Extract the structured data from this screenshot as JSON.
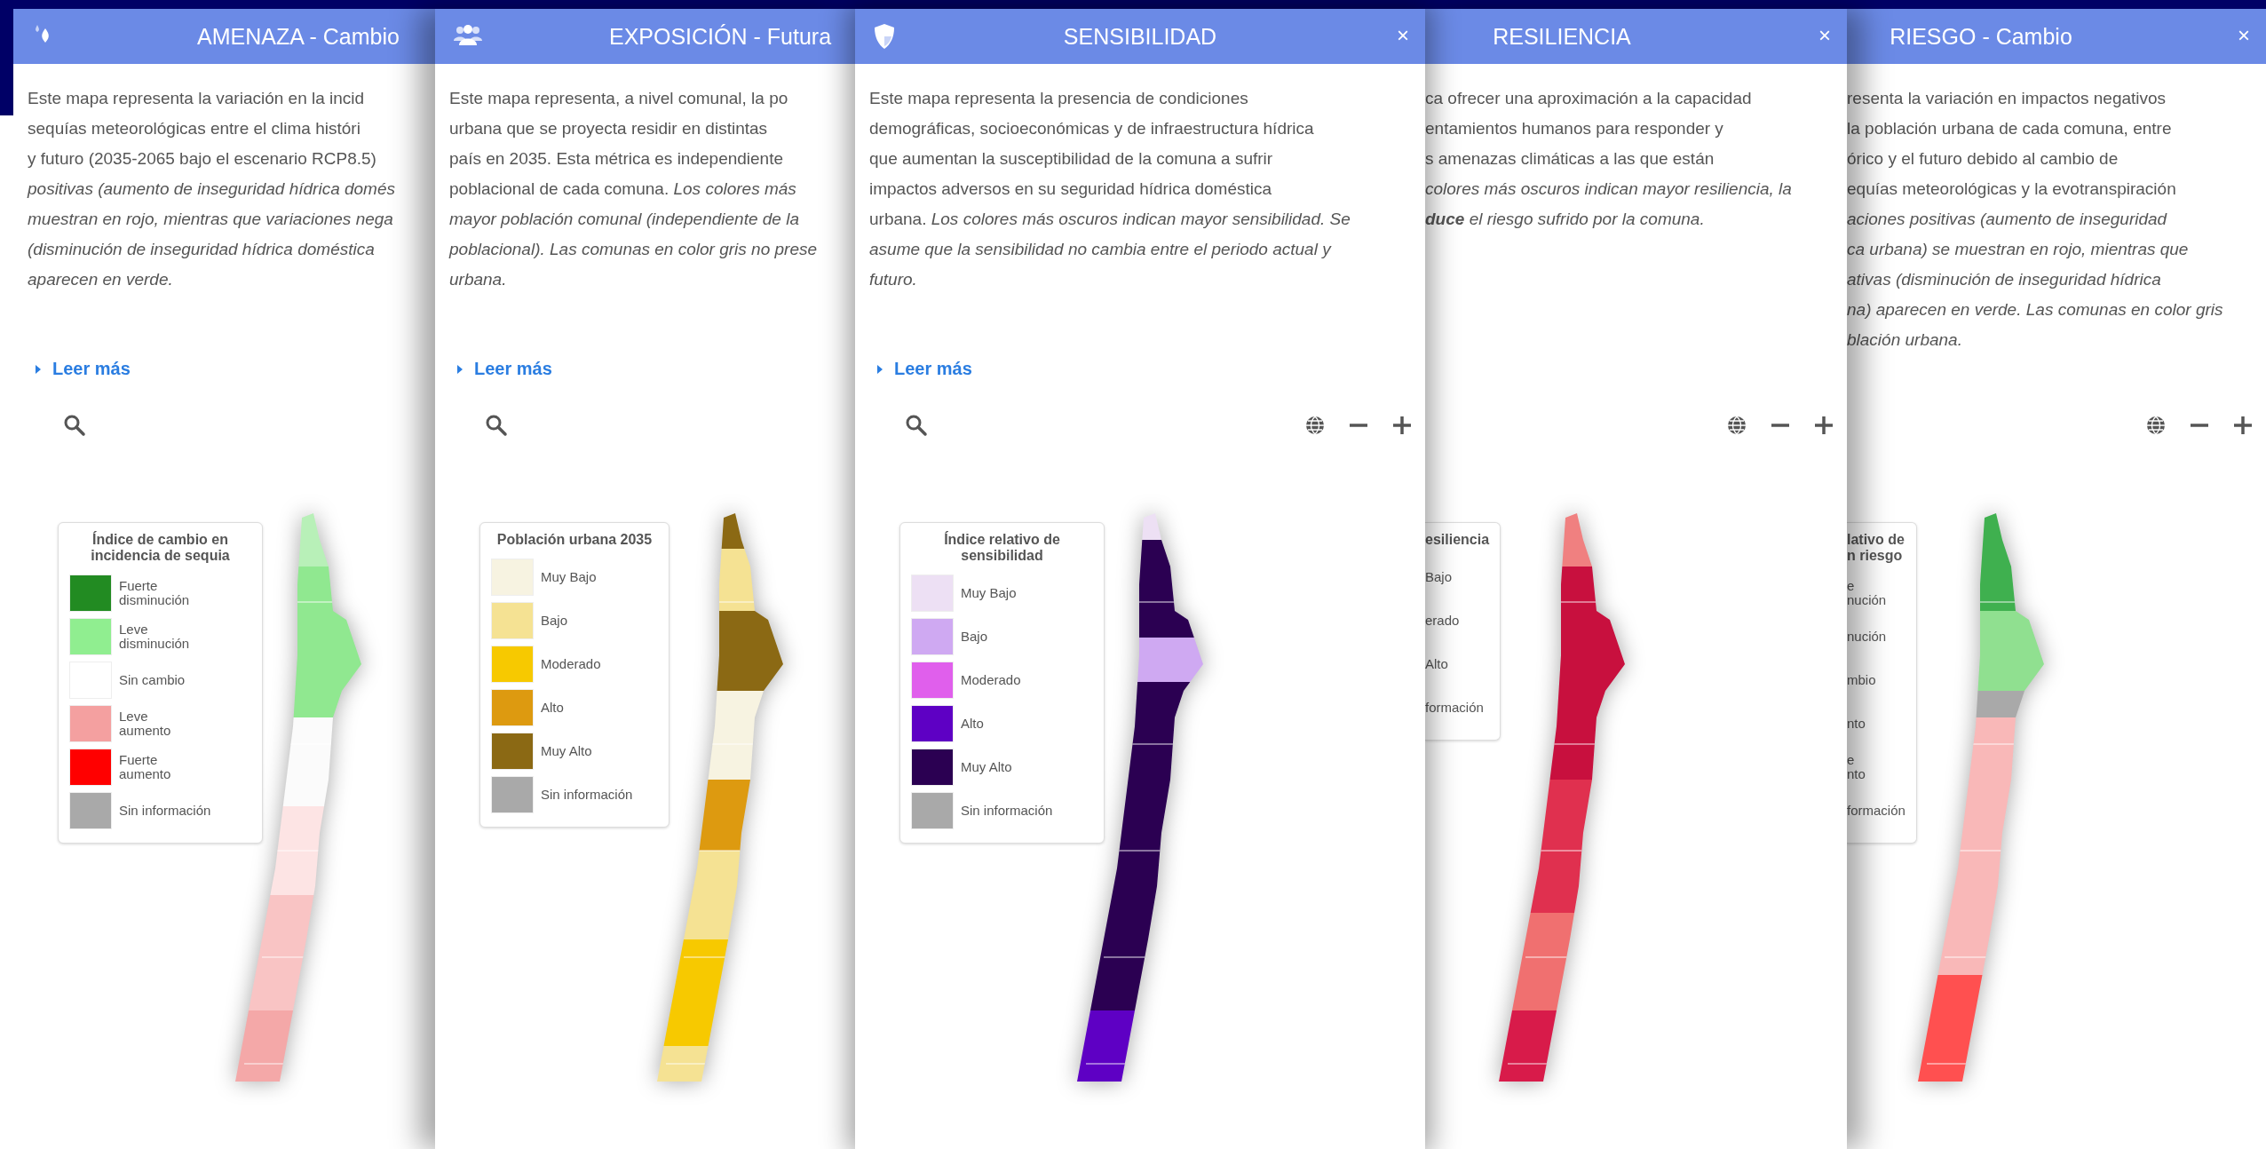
{
  "panels": [
    {
      "title": "AMENAZA - Cambio",
      "description": [
        {
          "text": "Este mapa representa la variación en la incid",
          "italic": false
        },
        {
          "text": "sequías meteorológicas entre el clima históri",
          "italic": false
        },
        {
          "text": "y futuro (2035-2065 bajo el escenario RCP8.5)",
          "italic": false
        },
        {
          "text": "positivas (aumento de inseguridad hídrica domés",
          "italic": true
        },
        {
          "text": "muestran en rojo, mientras que variaciones nega",
          "italic": true
        },
        {
          "text": "(disminución de inseguridad hídrica doméstica",
          "italic": true
        },
        {
          "text": "aparecen en verde.",
          "italic": true
        }
      ],
      "link": "Leer más",
      "toolbar": {
        "search": true,
        "map_controls": false
      },
      "legend": {
        "title_lines": [
          "Índice de cambio en",
          "incidencia de sequia"
        ],
        "items": [
          {
            "label": "Fuerte\ndisminución",
            "color": "#228b22"
          },
          {
            "label": "Leve\ndisminución",
            "color": "#90ee90"
          },
          {
            "label": "Sin cambio",
            "color": "#ffffff"
          },
          {
            "label": "Leve\naumento",
            "color": "#f4a0a0"
          },
          {
            "label": "Fuerte\naumento",
            "color": "#ff0000"
          },
          {
            "label": "Sin información",
            "color": "#a9a9a9"
          }
        ]
      }
    },
    {
      "title": "EXPOSICIÓN - Futura",
      "description": [
        {
          "text": "Este mapa representa, a nivel comunal, la po",
          "italic": false
        },
        {
          "text": "urbana que se proyecta residir en distintas",
          "italic": false
        },
        {
          "text": "país en 2035. Esta métrica es independiente",
          "italic": false
        },
        {
          "text": "poblacional de cada comuna. *Los colores más*",
          "italic": false
        },
        {
          "text": "mayor población comunal (independiente de la",
          "italic": true
        },
        {
          "text": "poblacional). Las comunas en color gris no prese",
          "italic": true
        },
        {
          "text": "urbana.",
          "italic": true
        }
      ],
      "link": "Leer más",
      "toolbar": {
        "search": true,
        "map_controls": false
      },
      "legend": {
        "title_lines": [
          "Población urbana 2035"
        ],
        "items": [
          {
            "label": "Muy Bajo",
            "color": "#f7f3e1"
          },
          {
            "label": "Bajo",
            "color": "#f5e293"
          },
          {
            "label": "Moderado",
            "color": "#f7c900"
          },
          {
            "label": "Alto",
            "color": "#dd9a10"
          },
          {
            "label": "Muy Alto",
            "color": "#8b6914"
          },
          {
            "label": "Sin información",
            "color": "#a9a9a9"
          }
        ]
      }
    },
    {
      "title": "SENSIBILIDAD",
      "close": "×",
      "description": [
        {
          "text": "Este mapa representa la presencia de condiciones",
          "italic": false
        },
        {
          "text": "demográficas, socioeconómicas y de infraestructura hídrica",
          "italic": false
        },
        {
          "text": "que aumentan la susceptibilidad de la comuna a sufrir",
          "italic": false
        },
        {
          "text": "impactos adversos en su seguridad hídrica doméstica",
          "italic": false
        },
        {
          "text": "urbana. *Los colores más oscuros indican mayor sensibilidad. Se*",
          "italic": false
        },
        {
          "text": "asume que la sensibilidad no cambia entre el periodo actual y",
          "italic": true
        },
        {
          "text": "futuro.",
          "italic": true
        }
      ],
      "link": "Leer más",
      "toolbar": {
        "search": true,
        "map_controls": true
      },
      "legend": {
        "title_lines": [
          "Índice relativo de",
          "sensibilidad"
        ],
        "items": [
          {
            "label": "Muy Bajo",
            "color": "#ede0f4"
          },
          {
            "label": "Bajo",
            "color": "#cfa9f2"
          },
          {
            "label": "Moderado",
            "color": "#e05fec"
          },
          {
            "label": "Alto",
            "color": "#5e00c4"
          },
          {
            "label": "Muy Alto",
            "color": "#2b0052"
          },
          {
            "label": "Sin información",
            "color": "#a9a9a9"
          }
        ]
      }
    },
    {
      "title": "RESILIENCIA",
      "close": "×",
      "description": [
        {
          "text": "ca ofrecer una aproximación a la capacidad",
          "italic": false
        },
        {
          "text": "entamientos humanos para responder y",
          "italic": false
        },
        {
          "text": "s amenazas climáticas a las que están",
          "italic": false
        },
        {
          "text": "colores más oscuros indican mayor resiliencia, la",
          "italic": true
        },
        {
          "text": "**duce** el riesgo sufrido por la comuna.",
          "italic": true
        }
      ],
      "toolbar": {
        "search": false,
        "map_controls": true
      },
      "legend": {
        "title_lines": [
          "esiliencia"
        ],
        "items": [
          {
            "label": "Bajo"
          },
          {
            "label": "erado"
          },
          {
            "label": "Alto"
          },
          {
            "label": "formación"
          }
        ]
      }
    },
    {
      "title": "RIESGO - Cambio",
      "close": "×",
      "description": [
        {
          "text": "resenta la variación en impactos negativos",
          "italic": false
        },
        {
          "text": "la población urbana de cada comuna, entre",
          "italic": false
        },
        {
          "text": "órico y el futuro debido al cambio de",
          "italic": false
        },
        {
          "text": "equías meteorológicas y la evotranspiración",
          "italic": false
        },
        {
          "text": "aciones positivas (aumento de inseguridad",
          "italic": true
        },
        {
          "text": "ca urbana) se muestran en rojo, mientras que",
          "italic": true
        },
        {
          "text": "ativas (disminución de inseguridad hídrica",
          "italic": true
        },
        {
          "text": "na) aparecen en verde. Las comunas en color gris",
          "italic": true
        },
        {
          "text": "blación urbana.",
          "italic": true
        }
      ],
      "toolbar": {
        "search": false,
        "map_controls": true
      },
      "legend": {
        "title_lines": [
          "lativo de",
          "n riesgo"
        ],
        "items": [
          {
            "label": "e\nnución"
          },
          {
            "label": "nución"
          },
          {
            "label": "mbio"
          },
          {
            "label": "nto"
          },
          {
            "label": "e\nnto"
          },
          {
            "label": "formación"
          }
        ]
      }
    }
  ]
}
